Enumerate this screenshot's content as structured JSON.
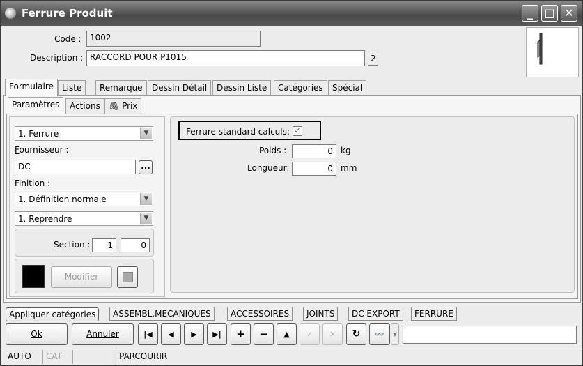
{
  "window": {
    "title": "Ferrure Produit"
  },
  "header": {
    "code_label": "Code :",
    "code_value": "1002",
    "description_label": "Description :",
    "description_value": "RACCORD POUR P1015",
    "description_badge": "2"
  },
  "main_tabs": [
    "Formulaire",
    "Liste",
    "Remarque",
    "Dessin Détail",
    "Dessin Liste",
    "Catégories",
    "Spécial"
  ],
  "sub_tabs": [
    "Paramètres",
    "Actions",
    "Prix"
  ],
  "left_panel": {
    "type_value": "1. Ferrure",
    "fournisseur_label": "Fournisseur :",
    "fournisseur_value": "DC",
    "browse_label": "...",
    "finition_label": "Finition :",
    "finition_value": "1. Définition normale",
    "reprendre_value": "1. Reprendre",
    "section_label": "Section :",
    "section_value_1": "1",
    "section_value_2": "0",
    "color_swatch": "#000000",
    "modifier_label": "Modifier"
  },
  "right_panel": {
    "standard_label": "Ferrure standard calculs:",
    "standard_checked": true,
    "poids_label": "Poids :",
    "poids_value": "0",
    "poids_unit": "kg",
    "longueur_label": "Longueur:",
    "longueur_value": "0",
    "longueur_unit": "mm"
  },
  "category_tabs": [
    "Appliquer catégories",
    "ASSEMBL.MECANIQUES",
    "ACCESSOIRES",
    "JOINTS",
    "DC EXPORT",
    "FERRURE"
  ],
  "buttons": {
    "ok": "Ok",
    "annuler": "Annuler"
  },
  "status_bar": [
    "AUTO",
    "CAT",
    "",
    "PARCOURIR"
  ]
}
